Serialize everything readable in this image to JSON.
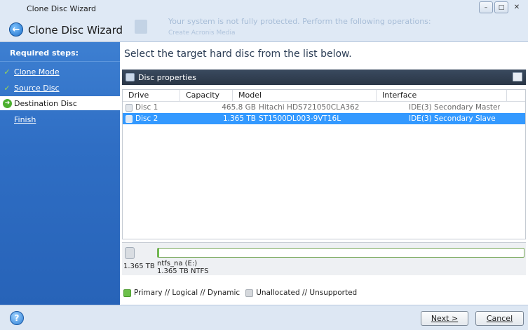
{
  "window": {
    "title": "Clone Disc Wizard",
    "wizard_title": "Clone Disc Wizard",
    "notice_text": "Your system is not fully protected. Perform the following operations:",
    "notice_link": "Create Acronis Media",
    "buttons": {
      "minimize": "–",
      "maximize": "□",
      "close": "✕"
    }
  },
  "sidebar": {
    "heading": "Required steps:",
    "steps": [
      {
        "label": "Clone Mode",
        "state": "done"
      },
      {
        "label": "Source Disc",
        "state": "done"
      },
      {
        "label": "Destination Disc",
        "state": "current"
      },
      {
        "label": "Finish",
        "state": "pending"
      }
    ]
  },
  "main": {
    "instruction": "Select the target hard disc from the list below.",
    "panel_title": "Disc properties",
    "columns": [
      "Drive",
      "Capacity",
      "Model",
      "Interface"
    ],
    "rows": [
      {
        "drive": "Disc 1",
        "capacity": "465.8 GB",
        "model": "Hitachi HDS721050CLA362",
        "interface": "IDE(3) Secondary Master",
        "selected": false
      },
      {
        "drive": "Disc 2",
        "capacity": "1.365 TB",
        "model": "ST1500DL003-9VT16L",
        "interface": "IDE(3) Secondary Slave",
        "selected": true
      }
    ],
    "disk_map": {
      "size": "1.365 TB",
      "partition_name": "ntfs_na (E:)",
      "partition_info": "1.365 TB  NTFS"
    },
    "legend": {
      "primary": "Primary // Logical // Dynamic",
      "unallocated": "Unallocated // Unsupported"
    }
  },
  "footer": {
    "help": "?",
    "next_label": "Next >",
    "cancel_label": "Cancel"
  },
  "colors": {
    "sidebar_bg": "#2f6ec4",
    "selection": "#3399ff",
    "partition_green": "#6cc04a",
    "check_green": "#9cd850"
  }
}
